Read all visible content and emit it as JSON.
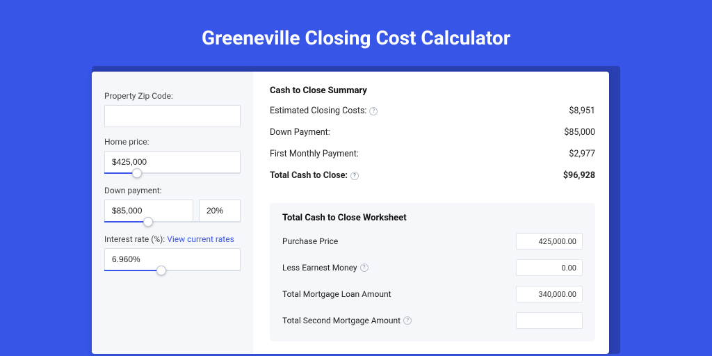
{
  "page_title": "Greeneville Closing Cost Calculator",
  "sidebar": {
    "zip_label": "Property Zip Code:",
    "zip_value": "",
    "home_price_label": "Home price:",
    "home_price_value": "$425,000",
    "down_payment_label": "Down payment:",
    "down_payment_value": "$85,000",
    "down_payment_pct": "20%",
    "interest_label": "Interest rate (%):",
    "interest_link": "View current rates",
    "interest_value": "6.960%"
  },
  "summary": {
    "title": "Cash to Close Summary",
    "rows": [
      {
        "label": "Estimated Closing Costs:",
        "help": true,
        "value": "$8,951"
      },
      {
        "label": "Down Payment:",
        "help": false,
        "value": "$85,000"
      },
      {
        "label": "First Monthly Payment:",
        "help": false,
        "value": "$2,977"
      }
    ],
    "total_label": "Total Cash to Close:",
    "total_value": "$96,928"
  },
  "worksheet": {
    "title": "Total Cash to Close Worksheet",
    "rows": [
      {
        "label": "Purchase Price",
        "help": false,
        "value": "425,000.00"
      },
      {
        "label": "Less Earnest Money",
        "help": true,
        "value": "0.00"
      },
      {
        "label": "Total Mortgage Loan Amount",
        "help": false,
        "value": "340,000.00"
      },
      {
        "label": "Total Second Mortgage Amount",
        "help": true,
        "value": ""
      }
    ]
  }
}
